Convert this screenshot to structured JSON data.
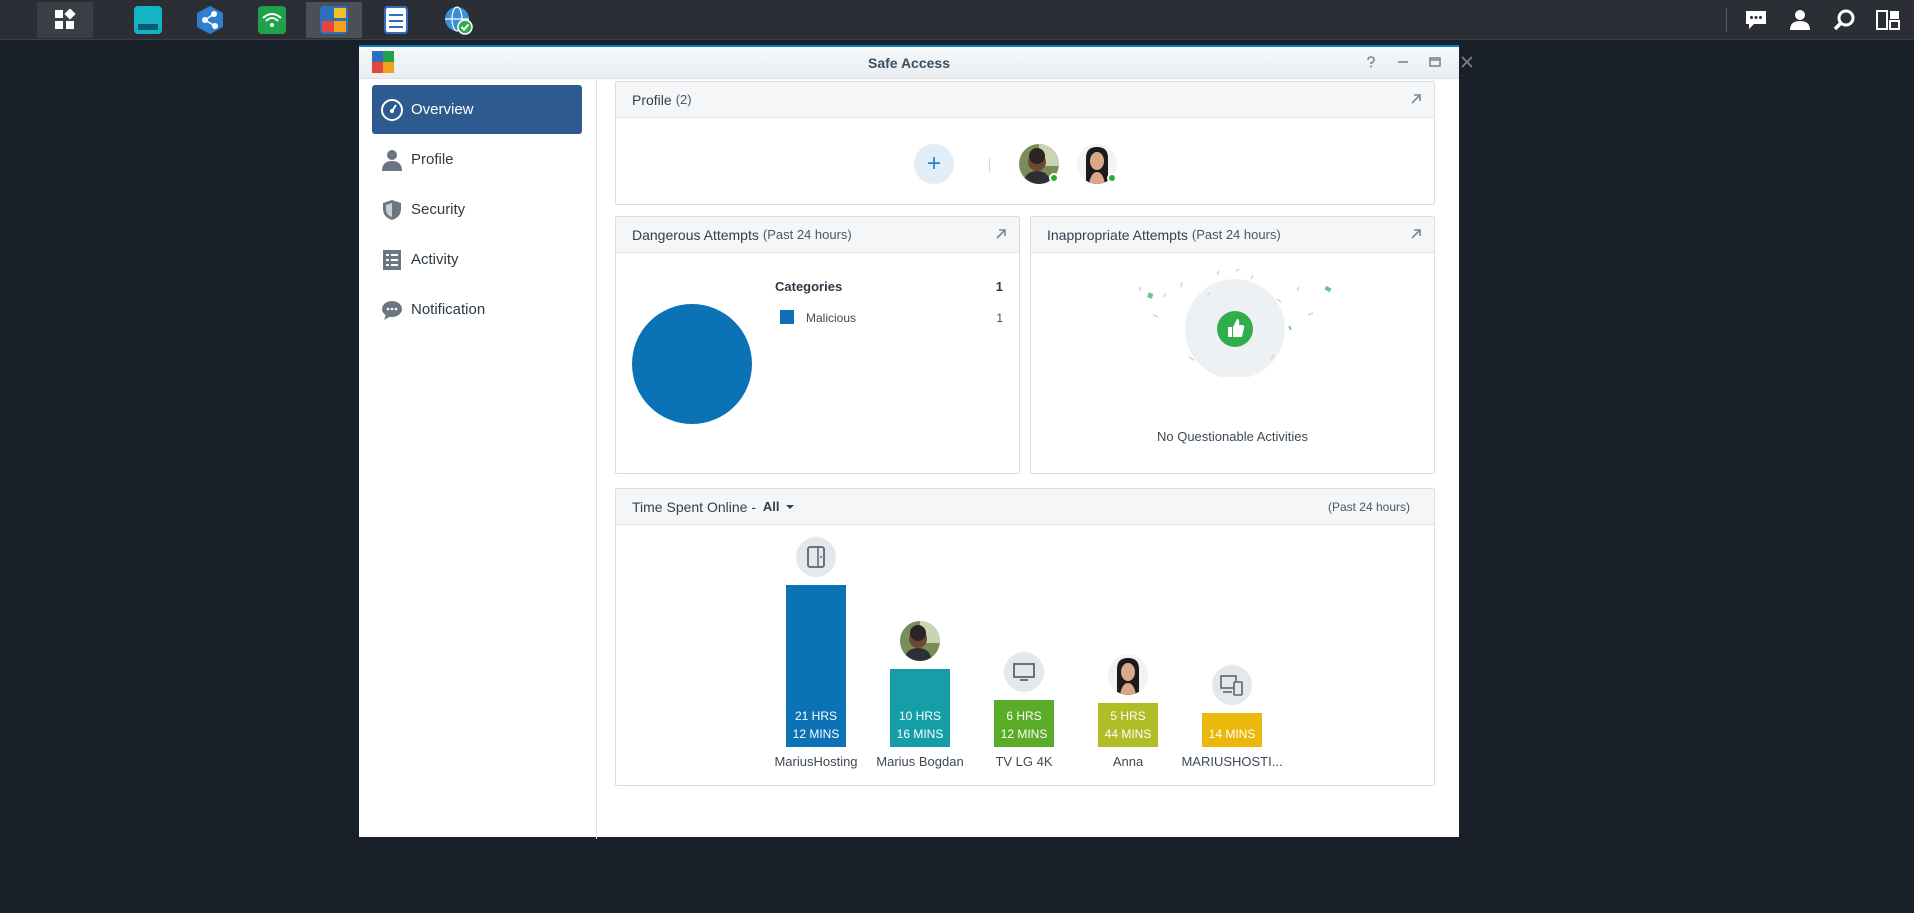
{
  "window": {
    "title": "Safe Access"
  },
  "sidebar": {
    "items": [
      {
        "label": "Overview",
        "icon": "gauge-icon"
      },
      {
        "label": "Profile",
        "icon": "person-icon"
      },
      {
        "label": "Security",
        "icon": "shield-icon"
      },
      {
        "label": "Activity",
        "icon": "list-icon"
      },
      {
        "label": "Notification",
        "icon": "chat-icon"
      }
    ]
  },
  "profile_panel": {
    "title": "Profile",
    "count": "(2)",
    "add_label": "+"
  },
  "dangerous_panel": {
    "title": "Dangerous Attempts",
    "subtitle": "(Past 24 hours)",
    "categories_label": "Categories",
    "categories_total": "1",
    "legend": [
      {
        "label": "Malicious",
        "value": "1",
        "color": "#0b72b5"
      }
    ]
  },
  "inappropriate_panel": {
    "title": "Inappropriate Attempts",
    "subtitle": "(Past 24 hours)",
    "empty_text": "No Questionable Activities"
  },
  "time_panel": {
    "title": "Time Spent Online - ",
    "filter": "All",
    "period": "(Past 24 hours)"
  },
  "chart_data": {
    "type": "bar",
    "categories": [
      "MariusHosting",
      "Marius Bogdan",
      "TV LG 4K",
      "Anna",
      "MARIUSHOSTI..."
    ],
    "series": [
      {
        "values": [
          1272,
          616,
          372,
          344,
          14
        ],
        "value_labels": [
          [
            "21 HRS",
            "12 MINS"
          ],
          [
            "10 HRS",
            "16 MINS"
          ],
          [
            "6 HRS",
            "12 MINS"
          ],
          [
            "5 HRS",
            "44 MINS"
          ],
          [
            "14 MINS"
          ]
        ],
        "colors": [
          "#0b72b5",
          "#159da8",
          "#5aab27",
          "#b0bd26",
          "#eab70b"
        ],
        "icons": [
          "tablet-icon",
          "avatar-man",
          "tv-icon",
          "avatar-woman",
          "devices-icon"
        ]
      }
    ],
    "unit": "minutes"
  },
  "colors": {
    "accent": "#2e5b8f",
    "online": "#27ae3a"
  }
}
